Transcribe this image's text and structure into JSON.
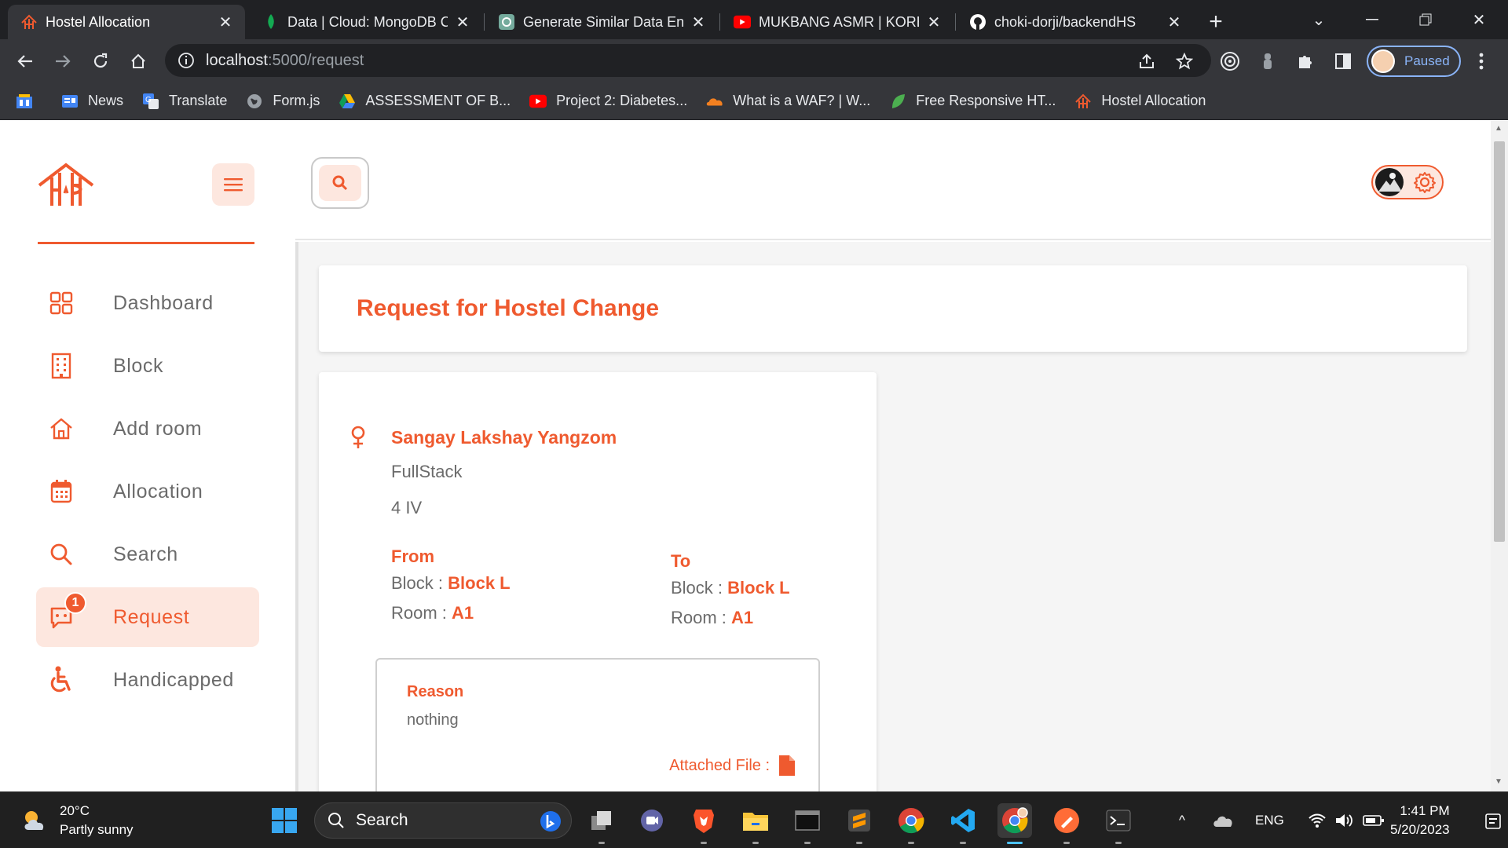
{
  "browser": {
    "tabs": [
      {
        "title": "Hostel Allocation",
        "active": true,
        "icon": "hostel-logo-icon"
      },
      {
        "title": "Data | Cloud: MongoDB Cloud",
        "active": false,
        "icon": "mongodb-leaf-icon"
      },
      {
        "title": "Generate Similar Data Entries",
        "active": false,
        "icon": "chatgpt-icon"
      },
      {
        "title": "MUKBANG ASMR | KOREAN",
        "active": false,
        "icon": "youtube-icon"
      },
      {
        "title": "choki-dorji/backendHS",
        "active": false,
        "icon": "github-icon"
      }
    ],
    "url_host": "localhost",
    "url_path": ":5000/request",
    "profile_label": "Paused",
    "bookmarks": [
      {
        "label": "",
        "icon": "apps-icon"
      },
      {
        "label": "News",
        "icon": "google-news-icon"
      },
      {
        "label": "Translate",
        "icon": "google-translate-icon"
      },
      {
        "label": "Form.js",
        "icon": "globe-icon"
      },
      {
        "label": "ASSESSMENT OF B...",
        "icon": "google-drive-icon"
      },
      {
        "label": "Project 2: Diabetes...",
        "icon": "youtube-icon"
      },
      {
        "label": "What is a WAF? | W...",
        "icon": "cloudflare-icon"
      },
      {
        "label": "Free Responsive HT...",
        "icon": "leaf-icon"
      },
      {
        "label": "Hostel Allocation",
        "icon": "hostel-logo-icon"
      }
    ]
  },
  "app": {
    "accent_color": "#ef5a2f",
    "accent_light": "#fde7df",
    "sidebar": {
      "items": [
        {
          "label": "Dashboard",
          "icon": "dashboard-grid-icon",
          "active": false
        },
        {
          "label": "Block",
          "icon": "building-icon",
          "active": false
        },
        {
          "label": "Add room",
          "icon": "home-icon",
          "active": false
        },
        {
          "label": "Allocation",
          "icon": "calendar-icon",
          "active": false
        },
        {
          "label": "Search",
          "icon": "search-icon",
          "active": false
        },
        {
          "label": "Request",
          "icon": "chat-icon",
          "active": true,
          "badge": "1"
        },
        {
          "label": "Handicapped",
          "icon": "wheelchair-icon",
          "active": false
        }
      ]
    },
    "page_title": "Request for Hostel Change",
    "request": {
      "student_name": "Sangay Lakshay Yangzom",
      "gender_icon": "female-icon",
      "course": "FullStack",
      "year": "4 IV",
      "from": {
        "title": "From",
        "block_label": "Block :",
        "block": "Block L",
        "room_label": "Room :",
        "room": "A1"
      },
      "to": {
        "title": "To",
        "block_label": "Block :",
        "block": "Block L",
        "room_label": "Room :",
        "room": "A1"
      },
      "reason_title": "Reason",
      "reason_text": "nothing",
      "attached_label": "Attached File :"
    }
  },
  "taskbar": {
    "weather_temp": "20°C",
    "weather_desc": "Partly sunny",
    "search_label": "Search",
    "language": "ENG",
    "time": "1:41 PM",
    "date": "5/20/2023"
  }
}
